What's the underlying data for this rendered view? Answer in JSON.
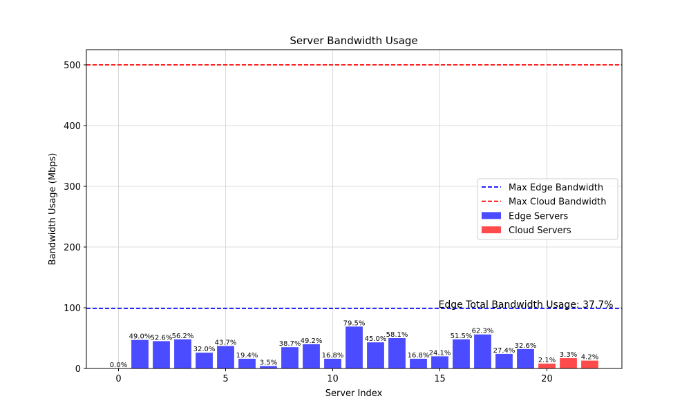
{
  "chart_data": {
    "type": "bar",
    "title": "Server Bandwidth Usage",
    "xlabel": "Server Index",
    "ylabel": "Bandwidth Usage (Mbps)",
    "xlim": [
      -1.5,
      23.5
    ],
    "ylim": [
      0,
      525
    ],
    "xticks": [
      0,
      5,
      10,
      15,
      20
    ],
    "yticks": [
      0,
      100,
      200,
      300,
      400,
      500
    ],
    "grid": true,
    "legend_position": "center-right",
    "series": [
      {
        "name": "Edge Servers",
        "color": "#4b4bff",
        "x": [
          0,
          1,
          2,
          3,
          4,
          5,
          6,
          7,
          8,
          9,
          10,
          11,
          12,
          13,
          14,
          15,
          16,
          17,
          18,
          19
        ],
        "values": [
          0,
          47,
          45,
          48,
          26,
          37,
          16,
          4,
          35,
          40,
          16,
          69,
          43,
          50,
          16,
          20,
          48,
          56,
          24,
          32
        ],
        "labels": [
          "0.0%",
          "49.0%",
          "52.6%",
          "56.2%",
          "32.0%",
          "43.7%",
          "19.4%",
          "3.5%",
          "38.7%",
          "49.2%",
          "16.8%",
          "79.5%",
          "45.0%",
          "58.1%",
          "16.8%",
          "24.1%",
          "51.5%",
          "62.3%",
          "27.4%",
          "32.6%"
        ]
      },
      {
        "name": "Cloud Servers",
        "color": "#ff4b4b",
        "x": [
          20,
          21,
          22
        ],
        "values": [
          8,
          17,
          13
        ],
        "labels": [
          "2.1%",
          "3.3%",
          "4.2%"
        ]
      }
    ],
    "reference_lines": [
      {
        "name": "Max Edge Bandwidth",
        "value": 99,
        "color": "#0000ff"
      },
      {
        "name": "Max Cloud Bandwidth",
        "value": 500,
        "color": "#ff0000"
      }
    ],
    "annotations": [
      {
        "text": "Edge Total Bandwidth Usage: 37.7%",
        "x": 15,
        "y": 99
      }
    ]
  }
}
